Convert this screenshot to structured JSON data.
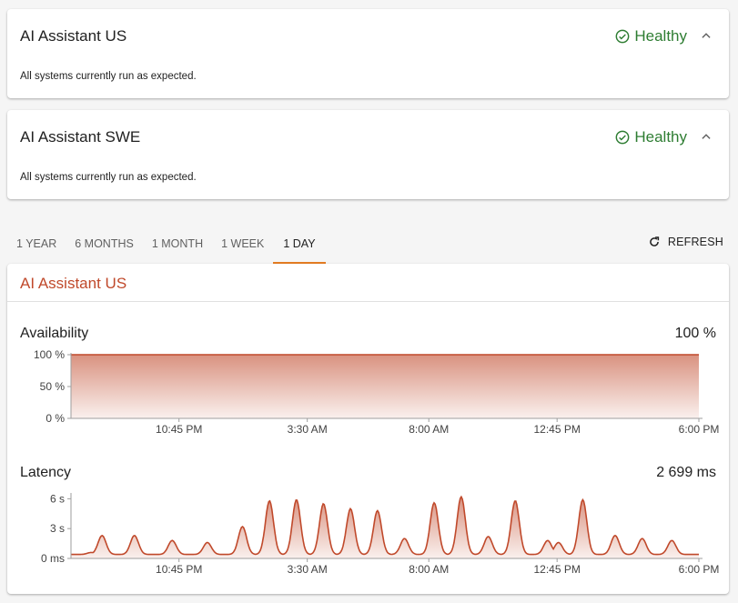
{
  "services": [
    {
      "name": "AI Assistant US",
      "status": "Healthy",
      "description": "All systems currently run as expected."
    },
    {
      "name": "AI Assistant SWE",
      "status": "Healthy",
      "description": "All systems currently run as expected."
    }
  ],
  "tabs": [
    {
      "label": "1 YEAR",
      "active": false
    },
    {
      "label": "6 MONTHS",
      "active": false
    },
    {
      "label": "1 MONTH",
      "active": false
    },
    {
      "label": "1 WEEK",
      "active": false
    },
    {
      "label": "1 DAY",
      "active": true
    }
  ],
  "refresh_label": "REFRESH",
  "chart_card": {
    "title": "AI Assistant US"
  },
  "colors": {
    "accent": "#c0492b",
    "healthy": "#2e7d32",
    "tab_indicator": "#e67e22"
  },
  "chart_data": [
    {
      "type": "area",
      "title": "Availability",
      "value_text": "100 %",
      "y_ticks": [
        "100 %",
        "50 %",
        "0 %"
      ],
      "x_ticks": [
        "10:45 PM",
        "3:30 AM",
        "8:00 AM",
        "12:45 PM",
        "6:00 PM"
      ],
      "ylim": [
        0,
        100
      ],
      "x_range_hours": [
        18.75,
        42.0
      ],
      "x_tick_hours": [
        22.75,
        27.5,
        32.0,
        36.75,
        42.0
      ],
      "x": [
        18.75,
        42.0
      ],
      "values": [
        100,
        100
      ],
      "grid": false,
      "legend": "none"
    },
    {
      "type": "area",
      "title": "Latency",
      "value_text": "2 699 ms",
      "y_ticks": [
        "6 s",
        "3 s",
        "0 ms"
      ],
      "x_ticks": [
        "10:45 PM",
        "3:30 AM",
        "8:00 AM",
        "12:45 PM",
        "6:00 PM"
      ],
      "ylim": [
        0,
        6.4
      ],
      "x_range_hours": [
        18.75,
        42.0
      ],
      "x_tick_hours": [
        22.75,
        27.5,
        32.0,
        36.75,
        42.0
      ],
      "baseline": 0.4,
      "spikes": [
        {
          "x": 19.5,
          "y": 0.6
        },
        {
          "x": 19.9,
          "y": 2.3
        },
        {
          "x": 21.1,
          "y": 2.3
        },
        {
          "x": 22.5,
          "y": 1.8
        },
        {
          "x": 23.8,
          "y": 1.6
        },
        {
          "x": 25.1,
          "y": 3.2
        },
        {
          "x": 26.1,
          "y": 5.8
        },
        {
          "x": 27.1,
          "y": 5.9
        },
        {
          "x": 28.1,
          "y": 5.5
        },
        {
          "x": 29.1,
          "y": 5.0
        },
        {
          "x": 30.1,
          "y": 4.8
        },
        {
          "x": 31.1,
          "y": 2.0
        },
        {
          "x": 32.2,
          "y": 5.6
        },
        {
          "x": 33.2,
          "y": 6.2
        },
        {
          "x": 34.2,
          "y": 2.2
        },
        {
          "x": 35.2,
          "y": 5.8
        },
        {
          "x": 36.4,
          "y": 1.8
        },
        {
          "x": 36.8,
          "y": 1.6
        },
        {
          "x": 37.7,
          "y": 5.9
        },
        {
          "x": 38.9,
          "y": 2.3
        },
        {
          "x": 39.9,
          "y": 2.0
        },
        {
          "x": 41.0,
          "y": 1.8
        }
      ],
      "grid": false,
      "legend": "none"
    }
  ]
}
